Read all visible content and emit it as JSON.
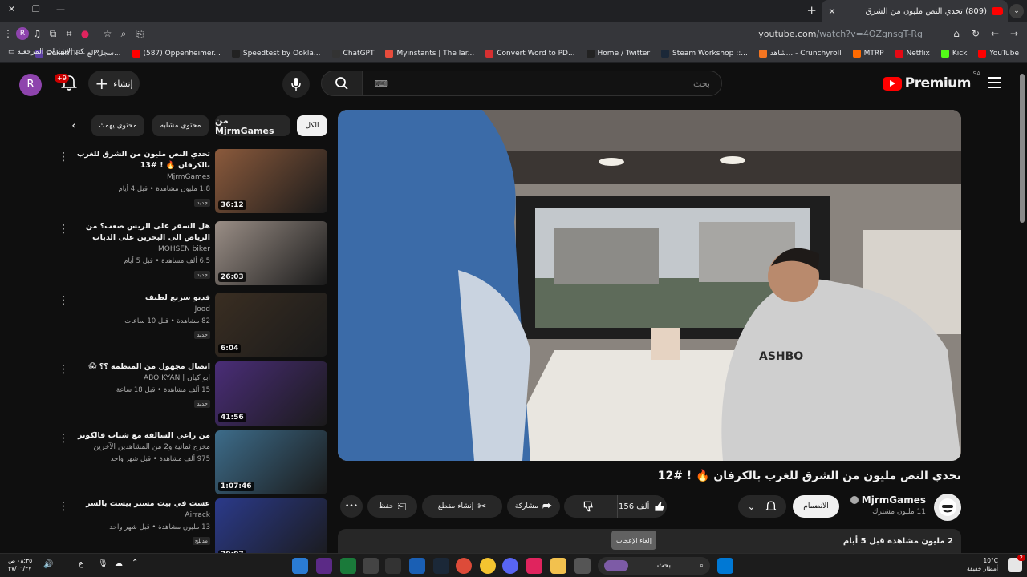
{
  "browser": {
    "tab_title": "(809) تحدي النص مليون من الشرق",
    "tab_count": "2",
    "url_host": "youtube.com",
    "url_path": "/watch?v=4OZgnsgT-Rg",
    "bookmarks": [
      {
        "label": "YouTube",
        "color": "#ff0000"
      },
      {
        "label": "Kick",
        "color": "#53fc18"
      },
      {
        "label": "Netflix",
        "color": "#e50914"
      },
      {
        "label": "MTRP",
        "color": "#ff6a00"
      },
      {
        "label": "شاهد... - Crunchyroll",
        "color": "#f47521"
      },
      {
        "label": "Steam Workshop ::...",
        "color": "#1b2838"
      },
      {
        "label": "Home / Twitter",
        "color": "#222222"
      },
      {
        "label": "Convert Word to PD...",
        "color": "#d63031"
      },
      {
        "label": "Myinstants | The lar...",
        "color": "#e74c3c"
      },
      {
        "label": "ChatGPT",
        "color": "#333333"
      },
      {
        "label": "Speedtest by Ookla...",
        "color": "#222222"
      },
      {
        "label": "(587) Oppenheimer...",
        "color": "#ff0000"
      },
      {
        "label": "DokanTIP - سجل الع...",
        "color": "#5b3fa0"
      }
    ],
    "all_bookmarks": "كل الإشارات المرجعية",
    "more_bookmarks": "»"
  },
  "header": {
    "logo": "Premium",
    "region": "SA",
    "search_placeholder": "بحث",
    "create_label": "إنشاء",
    "notifications": "+9",
    "avatar_letter": "R"
  },
  "video": {
    "title": "تحدي النص مليون من الشرق للغرب بالكرفان 🔥 ! #12",
    "channel": "MjrmGames",
    "subscribers": "11 مليون مشترك",
    "join_label": "الانضمام",
    "likes": "156 ألف",
    "share_label": "مشاركة",
    "clip_label": "إنشاء مقطع",
    "save_label": "حفظ",
    "more_label": "•••",
    "stats": "2 مليون مشاهدة  قبل 5 أيام",
    "tooltip": "إلغاء الإعجاب"
  },
  "chips": [
    {
      "label": "الكل",
      "active": true
    },
    {
      "label": "من MjrmGames",
      "active": false
    },
    {
      "label": "محتوى مشابه",
      "active": false
    },
    {
      "label": "محتوى يهمك",
      "active": false
    }
  ],
  "recommendations": [
    {
      "title": "تحدي النص مليون من الشرق للغرب بالكرفان 🔥 ! #13",
      "channel": "MjrmGames",
      "meta": "1.8 مليون مشاهدة • قبل 4 أيام",
      "badge": "جديد",
      "duration": "36:12",
      "thumb_color": "#8b5a3c"
    },
    {
      "title": "هل السفر على الريس صعب؟ من الرياض الى البحرين على الدباب",
      "channel": "MOHSEN biker",
      "meta": "6.5 ألف مشاهدة • قبل 5 أيام",
      "badge": "جديد",
      "duration": "26:03",
      "thumb_color": "#9a8e86"
    },
    {
      "title": "فديو سريع لطيف",
      "channel": "Jood",
      "meta": "82 مشاهدة • قبل 10 ساعات",
      "badge": "جديد",
      "duration": "6:04",
      "thumb_color": "#3a2e22"
    },
    {
      "title": "اتصال مجهول من المنظمه ؟؟ 😱",
      "channel": "ابو كيان | ABO KYAN",
      "meta": "15 ألف مشاهدة • قبل 18 ساعة",
      "badge": "جديد",
      "duration": "41:56",
      "thumb_color": "#4a2d78"
    },
    {
      "title": "من راعي السالفة مع شباب فالكونز",
      "channel": "مخرج ثمانية و2 من المشاهدين الآخرين",
      "meta": "975 ألف مشاهدة • قبل شهر واحد",
      "badge": "",
      "duration": "1:07:46",
      "thumb_color": "#3d6c8a"
    },
    {
      "title": "عشت في بيت مستر بيست بالسر",
      "channel": "Airrack",
      "meta": "13 مليون مشاهدة • قبل شهر واحد",
      "badge": "مدبلج",
      "duration": "20:07",
      "thumb_color": "#2b3a8a"
    }
  ],
  "taskbar": {
    "time": "٠٨:٣٥ ص",
    "date": "٢٧/٠٦/٢٧",
    "weather_temp": "10°C",
    "weather_desc": "أمطار خفيفة",
    "search_label": "بحث",
    "lang": "ع"
  }
}
